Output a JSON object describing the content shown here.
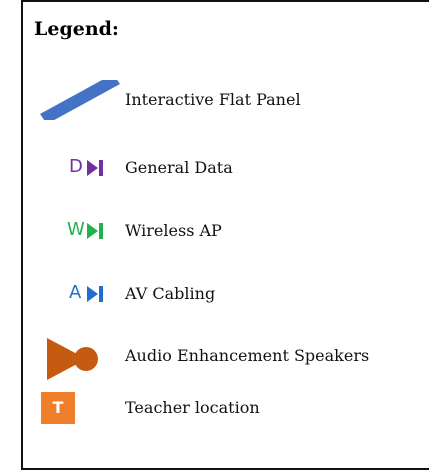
{
  "legend": {
    "title": "Legend:",
    "items": [
      {
        "label": "Interactive Flat Panel",
        "icon": "flat-panel-icon",
        "color": "#4472c4"
      },
      {
        "label": "General Data",
        "icon": "data-jack-icon",
        "letter": "D",
        "color": "#7030a0"
      },
      {
        "label": "Wireless AP",
        "icon": "wireless-ap-icon",
        "letter": "W",
        "color": "#22b14c"
      },
      {
        "label": "AV Cabling",
        "icon": "av-cabling-icon",
        "letter": "A",
        "color": "#1f6fd0"
      },
      {
        "label": "Audio Enhancement Speakers",
        "icon": "speaker-icon",
        "color": "#c55a11"
      },
      {
        "label": "Teacher location",
        "icon": "teacher-location-icon",
        "letter": "T",
        "color": "#ef7f2a"
      }
    ]
  }
}
